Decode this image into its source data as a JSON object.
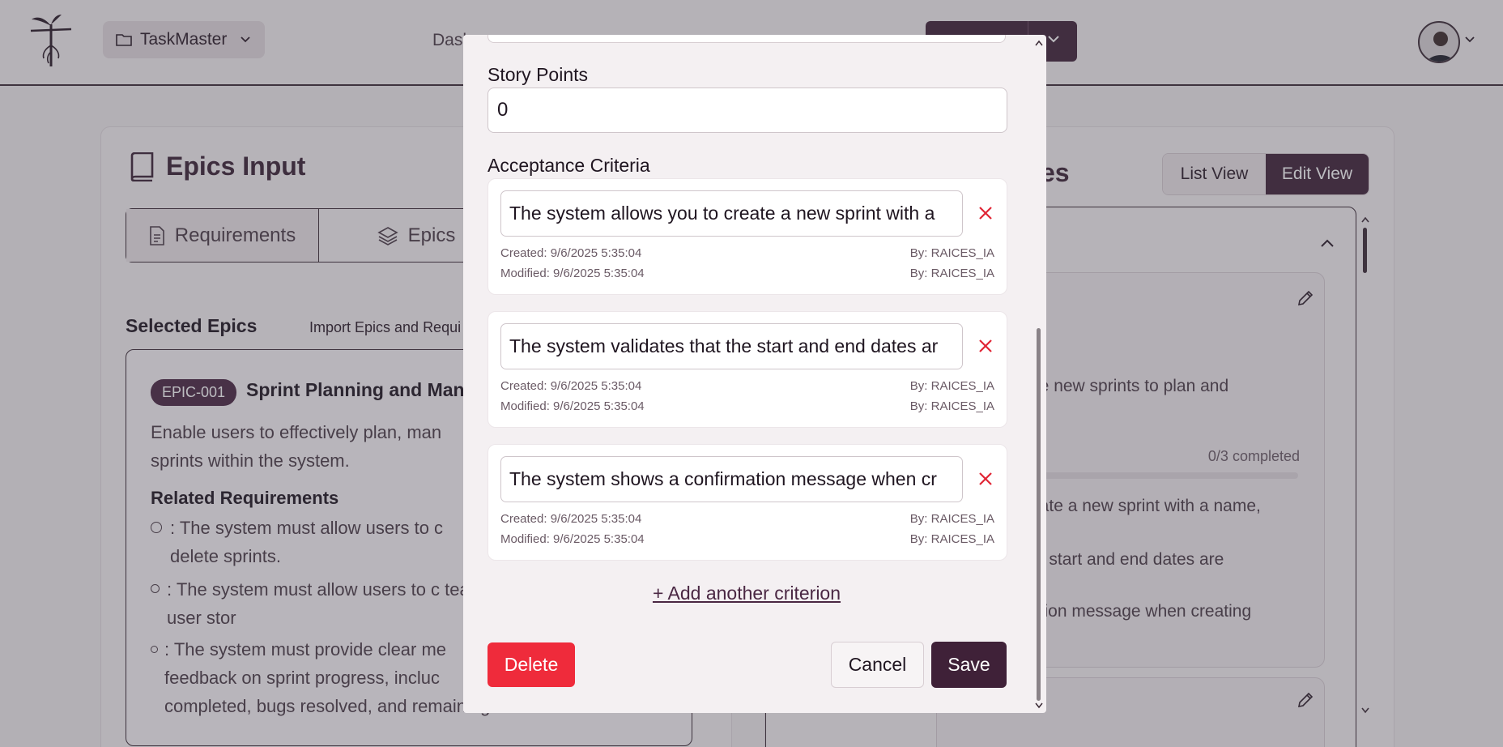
{
  "header": {
    "project_label": "TaskMaster",
    "nav_partial": "Dash"
  },
  "epics_panel": {
    "title": "Epics Input",
    "tabs": [
      {
        "label": "Requirements"
      },
      {
        "label": "Epics"
      }
    ],
    "selected_title": "Selected Epics",
    "import_link": "Import Epics and Requi",
    "epic": {
      "badge": "EPIC-001",
      "name": "Sprint Planning and Mana",
      "description": "Enable users to effectively plan, man\nsprints within the system.",
      "related_title": "Related Requirements",
      "requirements": [
        ": The system must allow users to c\ndelete sprints.",
        ": The system must allow users to c\nteam members to sprints, user stor",
        ": The system must provide clear me\nfeedback on sprint progress, incluc\ncompleted, bugs resolved, and remaining work."
      ]
    }
  },
  "stories_panel": {
    "title_partial": "es",
    "view_toggle": {
      "list": "List View",
      "edit": "Edit View"
    },
    "card": {
      "desc_line1": "create new sprints to plan and",
      "progress": "0/3 completed",
      "progress_fraction": 0,
      "items": [
        "o create a new sprint with a name,",
        "at the start and end dates are",
        "firmation message when creating"
      ]
    }
  },
  "modal": {
    "story_points_label": "Story Points",
    "story_points_value": "0",
    "acceptance_label": "Acceptance Criteria",
    "criteria": [
      {
        "text": "The system allows you to create a new sprint with a",
        "created": "Created: 9/6/2025 5:35:04",
        "modified": "Modified: 9/6/2025 5:35:04",
        "created_by": "By: RAICES_IA",
        "modified_by": "By: RAICES_IA"
      },
      {
        "text": "The system validates that the start and end dates ar",
        "created": "Created: 9/6/2025 5:35:04",
        "modified": "Modified: 9/6/2025 5:35:04",
        "created_by": "By: RAICES_IA",
        "modified_by": "By: RAICES_IA"
      },
      {
        "text": "The system shows a confirmation message when cr",
        "created": "Created: 9/6/2025 5:35:04",
        "modified": "Modified: 9/6/2025 5:35:04",
        "created_by": "By: RAICES_IA",
        "modified_by": "By: RAICES_IA"
      }
    ],
    "add_link": "+ Add another criterion",
    "delete_label": "Delete",
    "cancel_label": "Cancel",
    "save_label": "Save"
  },
  "colors": {
    "brand": "#3f2138",
    "danger": "#ef2b3b",
    "background": "#f1ecee"
  }
}
